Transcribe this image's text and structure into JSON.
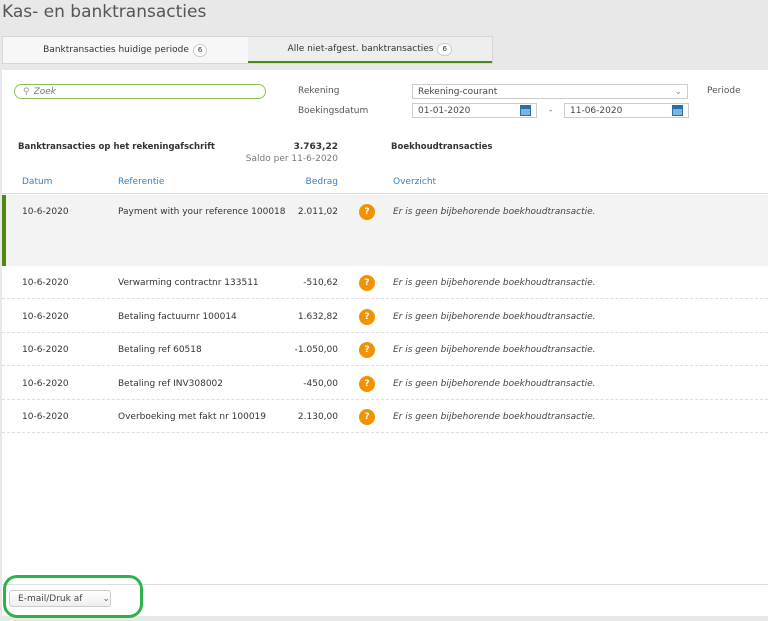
{
  "title": "Kas- en banktransacties",
  "tabs": [
    {
      "label": "Banktransacties huidige periode",
      "count": "6"
    },
    {
      "label": "Alle niet-afgest. banktransacties",
      "count": "6"
    }
  ],
  "search": {
    "placeholder": "Zoek"
  },
  "filters": {
    "rekening_label": "Rekening",
    "rekening_value": "Rekening-courant",
    "periode_label": "Periode",
    "datum_label": "Boekingsdatum",
    "from": "01-01-2020",
    "sep": "-",
    "to": "11-06-2020"
  },
  "summary": {
    "bank_title": "Banktransacties op het rekeningafschrift",
    "saldo": "3.763,22",
    "saldo_label": "Saldo per 11-6-2020",
    "boekhoud_title": "Boekhoudtransacties"
  },
  "columns": {
    "datum": "Datum",
    "referentie": "Referentie",
    "bedrag": "Bedrag",
    "overzicht": "Overzicht"
  },
  "rows": [
    {
      "date": "10-6-2020",
      "ref": "Payment with your reference 100018",
      "amount": "2.011,02",
      "status": "?",
      "text": "Er is geen bijbehorende boekhoudtransactie."
    },
    {
      "date": "10-6-2020",
      "ref": "Verwarming contractnr 133511",
      "amount": "-510,62",
      "status": "?",
      "text": "Er is geen bijbehorende boekhoudtransactie."
    },
    {
      "date": "10-6-2020",
      "ref": "Betaling factuurnr 100014",
      "amount": "1.632,82",
      "status": "?",
      "text": "Er is geen bijbehorende boekhoudtransactie."
    },
    {
      "date": "10-6-2020",
      "ref": "Betaling ref 60518",
      "amount": "-1.050,00",
      "status": "?",
      "text": "Er is geen bijbehorende boekhoudtransactie."
    },
    {
      "date": "10-6-2020",
      "ref": "Betaling ref INV308002",
      "amount": "-450,00",
      "status": "?",
      "text": "Er is geen bijbehorende boekhoudtransactie."
    },
    {
      "date": "10-6-2020",
      "ref": "Overboeking met fakt nr 100019",
      "amount": "2.130,00",
      "status": "?",
      "text": "Er is geen bijbehorende boekhoudtransactie."
    }
  ],
  "footer": {
    "email_print": "E-mail/Druk af"
  },
  "colors": {
    "accent": "#4f8a10",
    "status": "#f39200",
    "link": "#3a7fc0"
  }
}
